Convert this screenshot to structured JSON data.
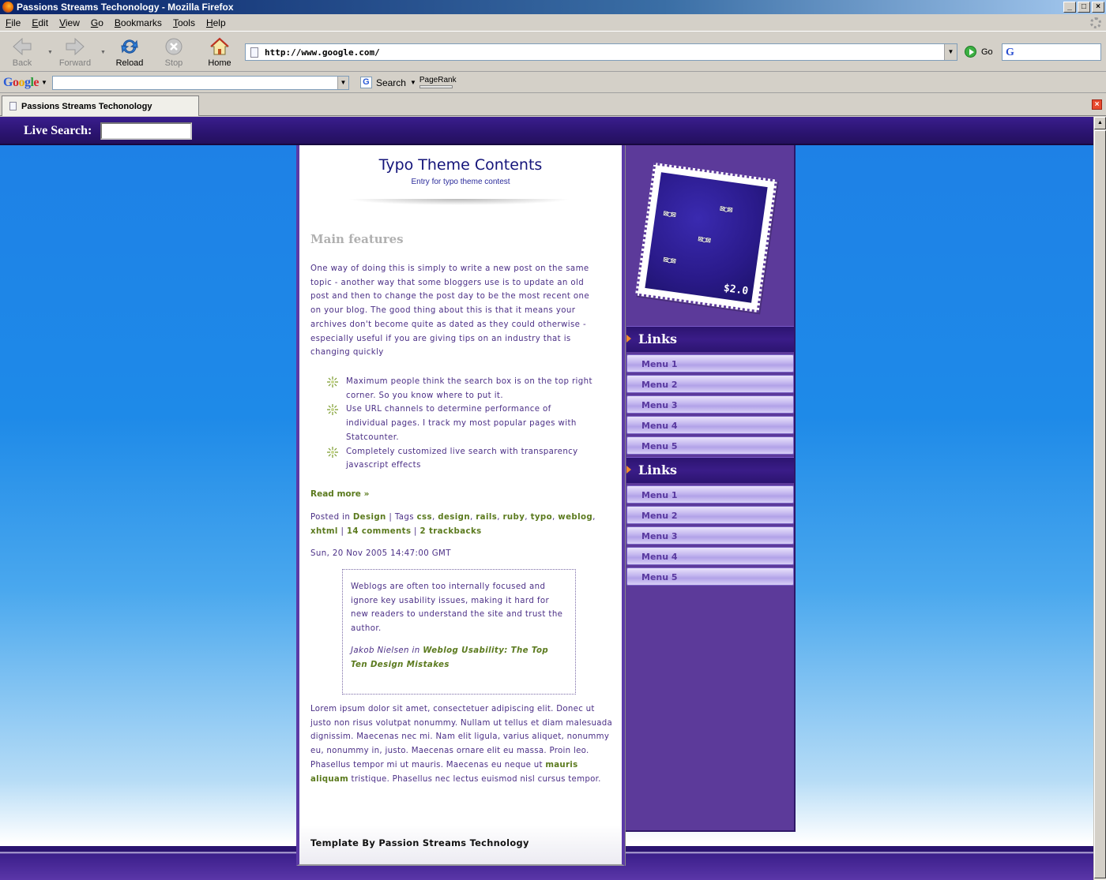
{
  "window": {
    "title": "Passions Streams Techonology - Mozilla Firefox"
  },
  "menubar": {
    "items": [
      "File",
      "Edit",
      "View",
      "Go",
      "Bookmarks",
      "Tools",
      "Help"
    ]
  },
  "navbar": {
    "back": "Back",
    "forward": "Forward",
    "reload": "Reload",
    "stop": "Stop",
    "home": "Home",
    "url": "http://www.google.com/",
    "go": "Go"
  },
  "googlebar": {
    "logo": "Google",
    "search": "Search",
    "pagerank": "PageRank"
  },
  "tab": {
    "title": "Passions Streams Techonology"
  },
  "page": {
    "live_search_label": "Live Search:",
    "blog_title": "Typo Theme Contents",
    "blog_subtitle": "Entry for typo theme contest",
    "post_title": "Main features",
    "post_para": "One way of doing this is simply to write a new post on the same topic - another way that some bloggers use is to update an old post and then to change the post day to be the most recent one on your blog. The good thing about this is that it means your archives don't become quite as dated as they could otherwise - especially useful if you are giving tips on an industry that is changing quickly",
    "bullets": [
      "Maximum people think the search box is on the top right corner. So you know where to put it.",
      "Use URL channels to determine performance of individual pages. I track my most popular pages with Statcounter.",
      "Completely customized live search with transparency javascript effects"
    ],
    "read_more": "Read more »",
    "meta": {
      "posted_in": "Posted in",
      "category": "Design",
      "tags_label": "| Tags",
      "tags": [
        "css",
        "design",
        "rails",
        "ruby",
        "typo",
        "weblog",
        "xhtml"
      ],
      "comments": "14 comments",
      "trackbacks": "2 trackbacks"
    },
    "date": "Sun, 20 Nov 2005 14:47:00 GMT",
    "quote": {
      "text": "Weblogs are often too internally focused and ignore key usability issues, making it hard for new readers to understand the site and trust the author.",
      "author": "Jakob Nielsen in",
      "source": "Weblog Usability: The Top Ten Design Mistakes"
    },
    "lorem_before": "Lorem ipsum dolor sit amet, consectetuer adipiscing elit. Donec ut justo non risus volutpat nonummy. Nullam ut tellus et diam malesuada dignissim. Maecenas nec mi. Nam elit ligula, varius aliquet, nonummy eu, nonummy in, justo. Maecenas ornare elit eu massa. Proin leo. Phasellus tempor mi ut mauris. Maecenas eu neque ut",
    "lorem_link": "mauris aliquam",
    "lorem_after": "tristique. Phasellus nec lectus euismod nisl cursus tempor.",
    "template_credit": "Template By Passion Streams Technology"
  },
  "sidebar": {
    "stamp_price": "$2.0",
    "sections": [
      {
        "title": "Links",
        "items": [
          "Menu 1",
          "Menu 2",
          "Menu 3",
          "Menu 4",
          "Menu 5"
        ]
      },
      {
        "title": "Links",
        "items": [
          "Menu 1",
          "Menu 2",
          "Menu 3",
          "Menu 4",
          "Menu 5"
        ]
      }
    ]
  },
  "colors": {
    "page_bg_blue": "#1e80e6",
    "purple_band": "#2b1470",
    "sidebar_purple": "#5c3a9a",
    "link_green": "#5b7a1e",
    "body_text": "#4b2f86"
  }
}
